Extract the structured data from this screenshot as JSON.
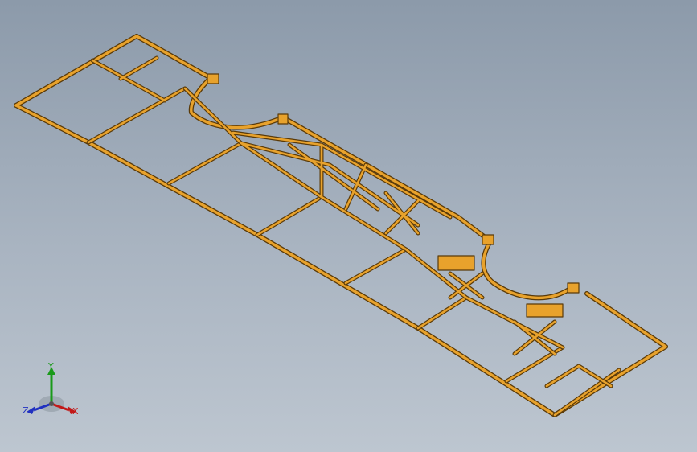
{
  "viewport": {
    "background_top": "#8c9aaa",
    "background_bottom": "#bdc6d0"
  },
  "model": {
    "material_color": "#e8a22c",
    "edge_color": "#5a3a08",
    "shade_color": "#b87414"
  },
  "triad": {
    "y_label": "Y",
    "x_label": "X",
    "z_label": "Z",
    "y_color": "#1a9a1a",
    "x_color": "#c21818",
    "z_color": "#2030c0"
  }
}
